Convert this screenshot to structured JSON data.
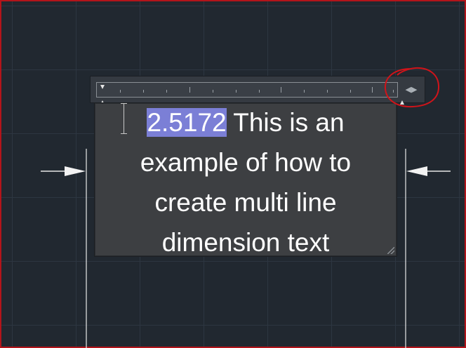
{
  "editor": {
    "selected_value": "2.5172",
    "lines": [
      " This is an",
      "example of how to",
      "create multi line",
      "dimension text"
    ]
  },
  "ruler": {
    "width_toggle_glyph": "◀▶"
  },
  "colors": {
    "canvas_background": "#212830",
    "grid_line": "#2d3641",
    "selection_highlight": "#7b7fd6",
    "annotation_circle": "#d0141a",
    "dimension_lines": "#e8e8e8"
  },
  "annotation": {
    "shape": "hand-drawn circle around ruler width toggle"
  }
}
